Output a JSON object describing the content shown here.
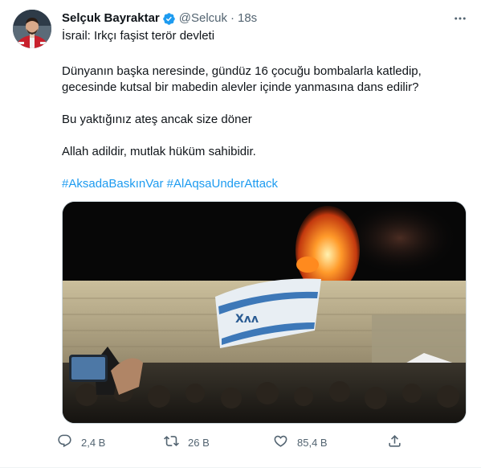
{
  "tweet": {
    "author_name": "Selçuk Bayraktar",
    "handle": "@Selcuk",
    "separator": "·",
    "time": "18s",
    "lines": [
      "İsrail: Irkçı faşist terör devleti",
      "Dünyanın başka neresinde, gündüz 16 çocuğu bombalarla katledip,",
      "gecesinde kutsal bir mabedin alevler içinde yanmasına dans edilir?",
      "Bu yaktığınız ateş ancak size döner",
      "Allah adildir, mutlak hüküm sahibidir."
    ],
    "hashtags": [
      "#AksadaBaskınVar",
      "#AlAqsaUnderAttack"
    ]
  },
  "actions": {
    "reply_count": "2,4 B",
    "retweet_count": "26 B",
    "like_count": "85,4 B"
  },
  "colors": {
    "link": "#1d9bf0",
    "secondary_text": "#536471",
    "verified": "#1d9bf0"
  },
  "icons": [
    "verified-badge-icon",
    "more-icon",
    "reply-icon",
    "retweet-icon",
    "like-icon",
    "share-icon"
  ]
}
